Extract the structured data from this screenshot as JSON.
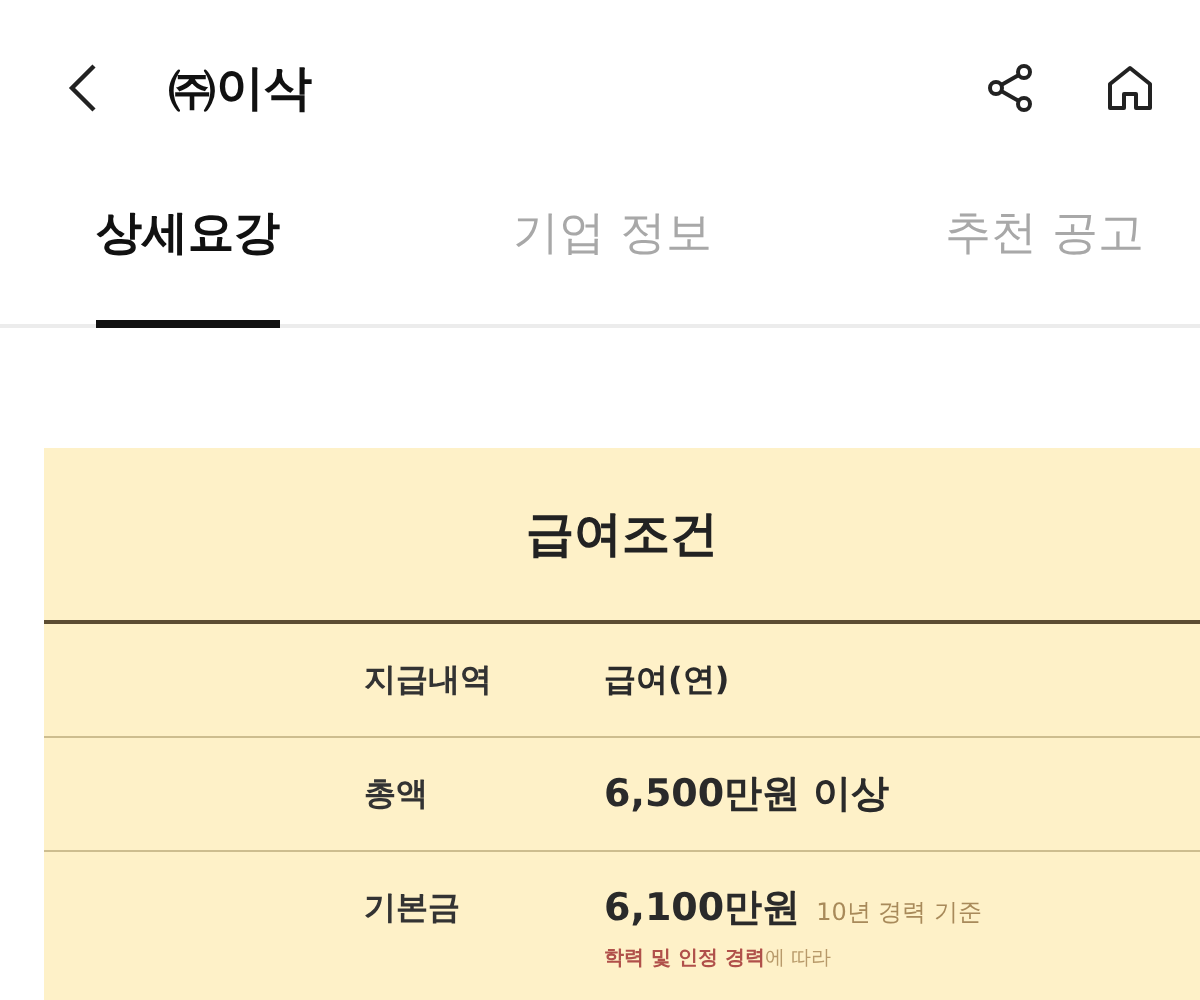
{
  "header": {
    "title": "㈜이삭"
  },
  "tabs": [
    {
      "label": "상세요강",
      "selected": true
    },
    {
      "label": "기업 정보",
      "selected": false
    },
    {
      "label": "추천 공고",
      "selected": false
    }
  ],
  "salary": {
    "title": "급여조건",
    "rows": [
      {
        "label": "지급내역",
        "value": "급여(연)",
        "kind": "plain"
      },
      {
        "label": "총액",
        "value": "6,500만원 이상",
        "kind": "bold"
      },
      {
        "label": "기본금",
        "value": "6,100만원",
        "note": "10년 경력 기준",
        "remark": "**학력 및 인정 경력**에 따라",
        "kind": "bold"
      }
    ]
  }
}
